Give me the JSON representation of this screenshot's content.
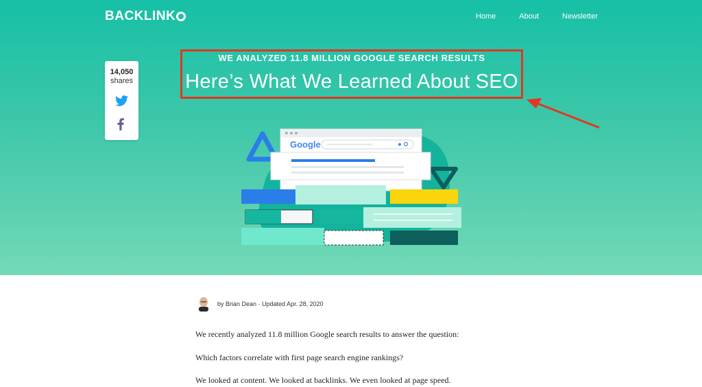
{
  "brand": {
    "logo_text": "BACKLINK"
  },
  "nav": {
    "items": [
      "Home",
      "About",
      "Newsletter"
    ]
  },
  "share": {
    "count": "14,050",
    "label": "shares"
  },
  "hero": {
    "kicker": "WE ANALYZED 11.8 MILLION GOOGLE SEARCH RESULTS",
    "headline": "Here’s What We Learned About SEO",
    "illustration_search_logo": "Google"
  },
  "article": {
    "byline": "by Brian Dean · Updated Apr. 28, 2020",
    "paragraphs": [
      "We recently analyzed 11.8 million Google search results to answer the question:",
      "Which factors correlate with first page search engine rankings?",
      "We looked at content. We looked at backlinks. We even looked at page speed."
    ]
  },
  "colors": {
    "hero_top": "#16c0a6",
    "hero_bottom": "#73d9b7",
    "annotation_red": "#e3371f",
    "twitter_blue": "#1da1f2",
    "facebook_purple": "#6b5b95"
  },
  "icons": [
    "twitter-icon",
    "facebook-icon",
    "author-avatar",
    "annotation-arrow"
  ]
}
